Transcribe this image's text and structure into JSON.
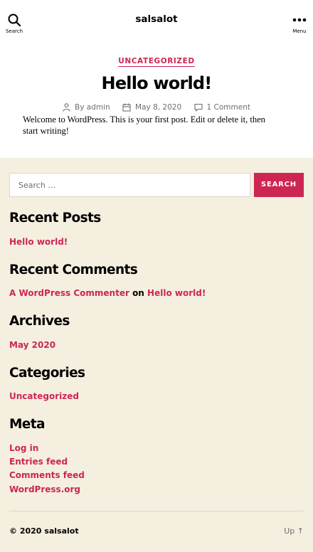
{
  "header": {
    "site_title": "salsalot",
    "search_label": "Search",
    "menu_label": "Menu"
  },
  "post": {
    "category": "UNCATEGORIZED",
    "title": "Hello world!",
    "author": "By admin",
    "date": "May 8, 2020",
    "comments": "1 Comment",
    "content": "Welcome to WordPress. This is your first post. Edit or delete it, then start writing!"
  },
  "search": {
    "placeholder": "Search …",
    "button_label": "SEARCH"
  },
  "widgets": {
    "recent_posts": {
      "title": "Recent Posts",
      "items": [
        "Hello world!"
      ]
    },
    "recent_comments": {
      "title": "Recent Comments",
      "author": "A WordPress Commenter",
      "on": "on",
      "post": "Hello world!"
    },
    "archives": {
      "title": "Archives",
      "items": [
        "May 2020"
      ]
    },
    "categories": {
      "title": "Categories",
      "items": [
        "Uncategorized"
      ]
    },
    "meta": {
      "title": "Meta",
      "items": [
        "Log in",
        "Entries feed",
        "Comments feed",
        "WordPress.org"
      ]
    }
  },
  "footer": {
    "copyright": "© 2020",
    "site_link": "salsalot",
    "up_label": "Up ↑"
  },
  "colors": {
    "accent": "#cd2653",
    "background": "#f5efe0",
    "muted": "#6d6d6d"
  },
  "icons": [
    "search-icon",
    "menu-dots-icon",
    "person-icon",
    "calendar-icon",
    "comment-icon"
  ]
}
